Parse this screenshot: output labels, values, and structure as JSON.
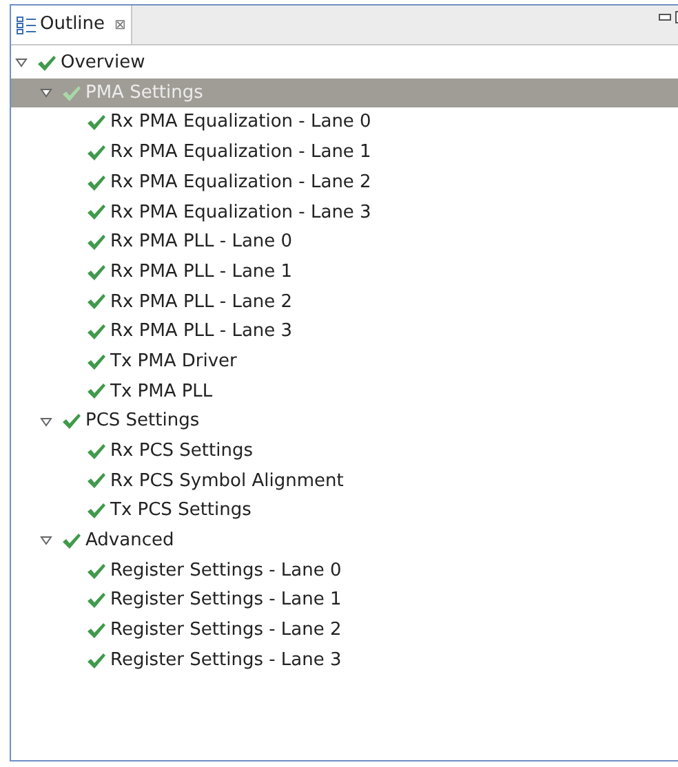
{
  "view_tab": {
    "title": "Outline",
    "close_glyph": "⊠"
  },
  "tree": [
    {
      "label": "Overview",
      "expanded": true,
      "selected": false,
      "children": [
        {
          "label": "PMA Settings",
          "expanded": true,
          "selected": true,
          "children": [
            {
              "label": "Rx PMA Equalization - Lane 0",
              "selected": false
            },
            {
              "label": "Rx PMA Equalization - Lane 1",
              "selected": false
            },
            {
              "label": "Rx PMA Equalization - Lane 2",
              "selected": false
            },
            {
              "label": "Rx PMA Equalization - Lane 3",
              "selected": false
            },
            {
              "label": "Rx PMA PLL - Lane 0",
              "selected": false
            },
            {
              "label": "Rx PMA PLL - Lane 1",
              "selected": false
            },
            {
              "label": "Rx PMA PLL - Lane 2",
              "selected": false
            },
            {
              "label": "Rx PMA PLL - Lane 3",
              "selected": false
            },
            {
              "label": "Tx PMA Driver",
              "selected": false
            },
            {
              "label": "Tx PMA PLL",
              "selected": false
            }
          ]
        },
        {
          "label": "PCS Settings",
          "expanded": true,
          "selected": false,
          "children": [
            {
              "label": "Rx PCS Settings",
              "selected": false
            },
            {
              "label": "Rx PCS Symbol Alignment",
              "selected": false
            },
            {
              "label": "Tx PCS Settings",
              "selected": false
            }
          ]
        },
        {
          "label": "Advanced",
          "expanded": true,
          "selected": false,
          "children": [
            {
              "label": "Register Settings - Lane 0",
              "selected": false
            },
            {
              "label": "Register Settings - Lane 1",
              "selected": false
            },
            {
              "label": "Register Settings - Lane 2",
              "selected": false
            },
            {
              "label": "Register Settings - Lane 3",
              "selected": false
            }
          ]
        }
      ]
    }
  ]
}
